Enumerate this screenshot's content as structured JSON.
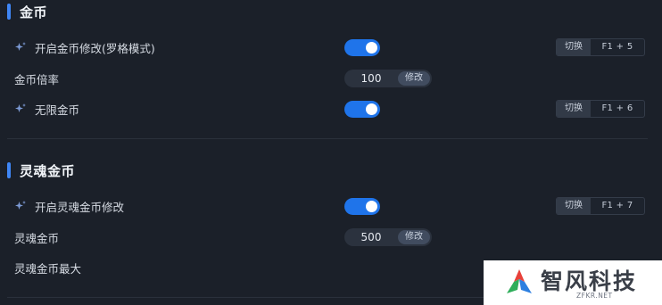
{
  "colors": {
    "background": "#1b2029",
    "accent": "#1f74ea",
    "section_bar": "#3f86f5"
  },
  "sections": [
    {
      "title": "金币",
      "rows": [
        {
          "label": "开启金币修改(罗格模式)",
          "icon": "sparkle-icon",
          "control": "toggle",
          "enabled": true,
          "hotkey_action": "切换",
          "hotkey": "F1 + 5"
        },
        {
          "label": "金币倍率",
          "control": "stepper",
          "value": "100",
          "apply_label": "修改"
        },
        {
          "label": "无限金币",
          "icon": "sparkle-icon",
          "control": "toggle",
          "enabled": true,
          "hotkey_action": "切换",
          "hotkey": "F1 + 6"
        }
      ]
    },
    {
      "title": "灵魂金币",
      "rows": [
        {
          "label": "开启灵魂金币修改",
          "icon": "sparkle-icon",
          "control": "toggle",
          "enabled": true,
          "hotkey_action": "切换",
          "hotkey": "F1 + 7"
        },
        {
          "label": "灵魂金币",
          "control": "stepper",
          "value": "500",
          "apply_label": "修改"
        },
        {
          "label": "灵魂金币最大"
        }
      ]
    }
  ],
  "watermark": {
    "name": "智风科技",
    "domain": "ZFKR.NET",
    "icon": "zf-logo-icon"
  }
}
